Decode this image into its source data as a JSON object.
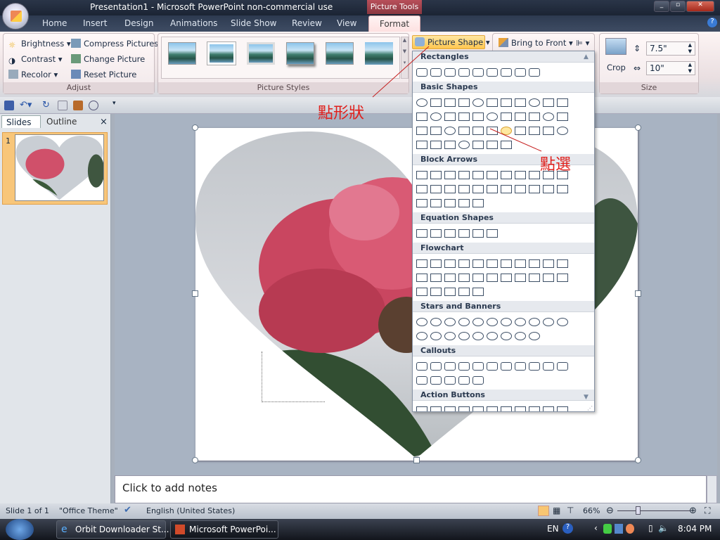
{
  "window": {
    "title": "Presentation1 - Microsoft PowerPoint non-commercial use",
    "context_tab": "Picture Tools"
  },
  "tabs": [
    "Home",
    "Insert",
    "Design",
    "Animations",
    "Slide Show",
    "Review",
    "View",
    "Format"
  ],
  "ribbon": {
    "adjust": {
      "label": "Adjust",
      "brightness": "Brightness",
      "contrast": "Contrast",
      "recolor": "Recolor",
      "compress": "Compress Pictures",
      "change": "Change Picture",
      "reset": "Reset Picture"
    },
    "styles": {
      "label": "Picture Styles"
    },
    "arrange": {
      "picture_shape": "Picture Shape",
      "bring_front": "Bring to Front"
    },
    "size": {
      "label": "Size",
      "crop": "Crop",
      "height": "7.5\"",
      "width": "10\""
    }
  },
  "left_pane": {
    "tab_slides": "Slides",
    "tab_outline": "Outline",
    "close": "×",
    "slide_number": "1"
  },
  "notes": {
    "placeholder": "Click to add notes"
  },
  "shape_menu": {
    "sections": [
      "Rectangles",
      "Basic Shapes",
      "Block Arrows",
      "Equation Shapes",
      "Flowchart",
      "Stars and Banners",
      "Callouts",
      "Action Buttons"
    ]
  },
  "annotations": {
    "click_shape": "點形狀",
    "click_select": "點選"
  },
  "status": {
    "slide": "Slide 1 of 1",
    "theme": "\"Office Theme\"",
    "language": "English (United States)",
    "zoom": "66%"
  },
  "taskbar": {
    "task1": "Orbit Downloader St...",
    "task2": "Microsoft PowerPoi...",
    "lang": "EN",
    "time": "8:04 PM"
  }
}
